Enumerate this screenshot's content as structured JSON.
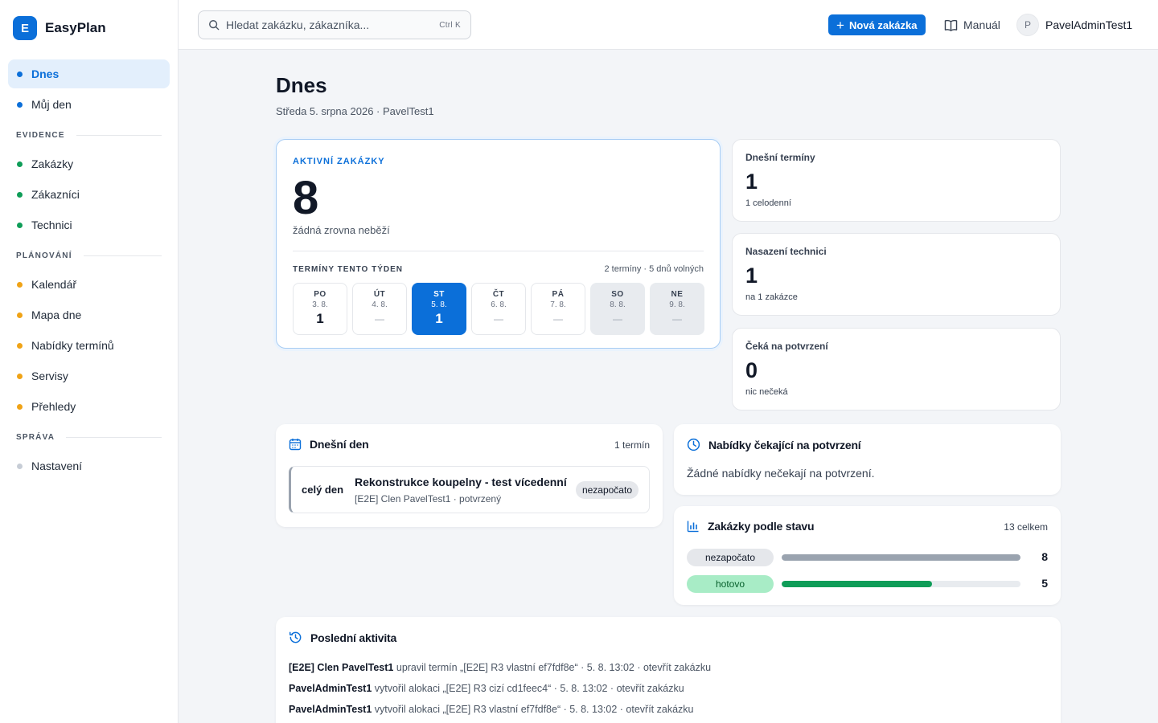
{
  "brand": {
    "logo": "E",
    "name": "EasyPlan"
  },
  "sidebar": {
    "items_top": [
      {
        "label": "Dnes",
        "active": true,
        "color": "blue"
      },
      {
        "label": "Můj den",
        "active": false,
        "color": "blue"
      }
    ],
    "sections": [
      {
        "label": "EVIDENCE",
        "items": [
          {
            "label": "Zakázky",
            "color": "green"
          },
          {
            "label": "Zákazníci",
            "color": "green"
          },
          {
            "label": "Technici",
            "color": "green"
          }
        ]
      },
      {
        "label": "PLÁNOVÁNÍ",
        "items": [
          {
            "label": "Kalendář",
            "color": "orange"
          },
          {
            "label": "Mapa dne",
            "color": "orange"
          },
          {
            "label": "Nabídky termínů",
            "color": "orange"
          },
          {
            "label": "Servisy",
            "color": "orange"
          },
          {
            "label": "Přehledy",
            "color": "orange"
          }
        ]
      },
      {
        "label": "SPRÁVA",
        "items": [
          {
            "label": "Nastavení",
            "color": "gray"
          }
        ]
      }
    ]
  },
  "topbar": {
    "search_placeholder": "Hledat zakázku, zákazníka...",
    "search_shortcut": "Ctrl K",
    "new_button": "Nová zakázka",
    "manual": "Manuál",
    "user_initial": "P",
    "user_name": "PavelAdminTest1"
  },
  "page": {
    "title": "Dnes",
    "subtitle": "Středa 5. srpna 2026 · PavelTest1"
  },
  "hero": {
    "label": "AKTIVNÍ ZAKÁZKY",
    "value": "8",
    "note": "žádná zrovna neběží",
    "week_label": "TERMÍNY TENTO TÝDEN",
    "week_summary": "2 termíny · 5 dnů volných",
    "days": [
      {
        "name": "PO",
        "date": "3. 8.",
        "count": "1",
        "today": false,
        "weekend": false
      },
      {
        "name": "ÚT",
        "date": "4. 8.",
        "count": "—",
        "today": false,
        "weekend": false
      },
      {
        "name": "ST",
        "date": "5. 8.",
        "count": "1",
        "today": true,
        "weekend": false
      },
      {
        "name": "ČT",
        "date": "6. 8.",
        "count": "—",
        "today": false,
        "weekend": false
      },
      {
        "name": "PÁ",
        "date": "7. 8.",
        "count": "—",
        "today": false,
        "weekend": false
      },
      {
        "name": "SO",
        "date": "8. 8.",
        "count": "—",
        "today": false,
        "weekend": true
      },
      {
        "name": "NE",
        "date": "9. 8.",
        "count": "—",
        "today": false,
        "weekend": true
      }
    ]
  },
  "stats": [
    {
      "label": "Dnešní termíny",
      "value": "1",
      "note": "1 celodenní"
    },
    {
      "label": "Nasazení technici",
      "value": "1",
      "note": "na 1 zakázce"
    },
    {
      "label": "Čeká na potvrzení",
      "value": "0",
      "note": "nic nečeká"
    }
  ],
  "today_panel": {
    "title": "Dnešní den",
    "meta": "1 termín",
    "event": {
      "time": "celý den",
      "title": "Rekonstrukce koupelny - test vícedenní",
      "sub": "[E2E] Clen PavelTest1 · potvrzený",
      "status": "nezapočato"
    }
  },
  "offers_panel": {
    "title": "Nabídky čekající na potvrzení",
    "empty": "Žádné nabídky nečekají na potvrzení."
  },
  "status_panel": {
    "title": "Zakázky podle stavu",
    "meta": "13 celkem",
    "rows": [
      {
        "label": "nezapočato",
        "count": "8",
        "fraction": 1.0,
        "pill": "gray",
        "color": "#9aa3af"
      },
      {
        "label": "hotovo",
        "count": "5",
        "fraction": 0.63,
        "pill": "green",
        "color": "#0f9d58"
      }
    ]
  },
  "activity_panel": {
    "title": "Poslední aktivita",
    "items": [
      {
        "actor": "[E2E] Clen PavelTest1",
        "text": " upravil termín „[E2E] R3 vlastní ef7fdf8e“ · 5. 8. 13:02 · ",
        "link": "otevřít zakázku"
      },
      {
        "actor": "PavelAdminTest1",
        "text": " vytvořil alokaci „[E2E] R3 cizí cd1feec4“ · 5. 8. 13:02 · ",
        "link": "otevřít zakázku"
      },
      {
        "actor": "PavelAdminTest1",
        "text": " vytvořil alokaci „[E2E] R3 vlastní ef7fdf8e“ · 5. 8. 13:02 · ",
        "link": "otevřít zakázku"
      }
    ]
  },
  "colors": {
    "accent": "#0b6fd9",
    "success": "#0f9d58",
    "warning": "#f0a316"
  }
}
